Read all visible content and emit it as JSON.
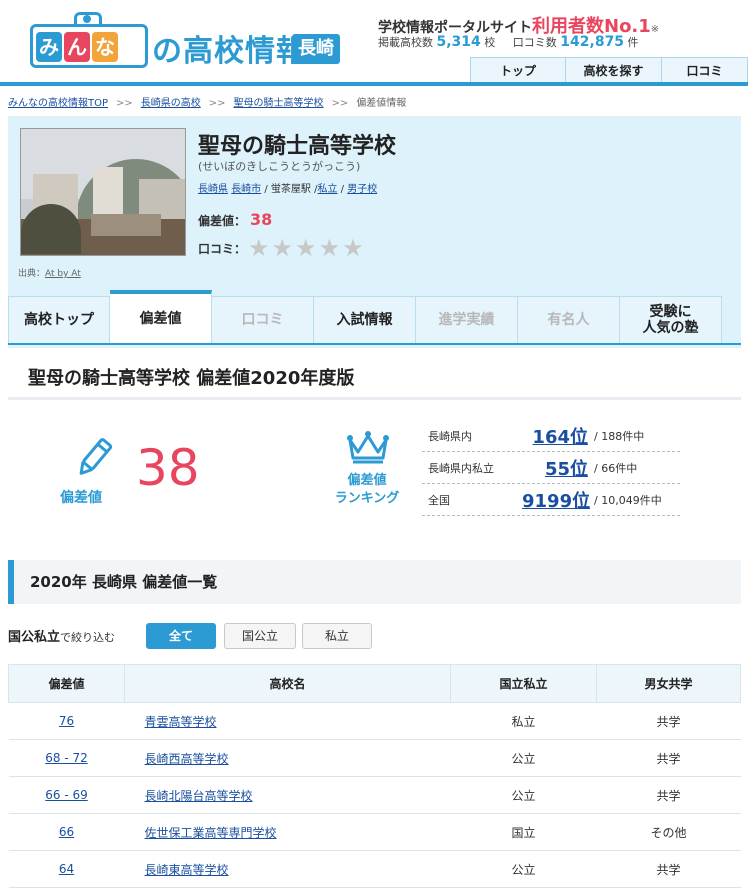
{
  "logo": {
    "chars": [
      {
        "text": "み",
        "color": "#2c9ad3"
      },
      {
        "text": "ん",
        "color": "#e8465e"
      },
      {
        "text": "な",
        "color": "#f2a33a"
      }
    ],
    "main": "の高校情報",
    "pref": "長崎"
  },
  "tagline": {
    "prefix": "学校情報ポータルサイト",
    "highlight": "利用者数No.1",
    "mark": "※"
  },
  "stats": {
    "schools_label": "掲載高校数",
    "schools_value": "5,314",
    "schools_unit": "校",
    "reviews_label": "口コミ数",
    "reviews_value": "142,875",
    "reviews_unit": "件"
  },
  "topnav": [
    "トップ",
    "高校を探す",
    "口コミ"
  ],
  "breadcrumb": [
    "みんなの高校情報TOP",
    "長崎県の高校",
    "聖母の騎士高等学校",
    "偏差値情報"
  ],
  "breadcrumb_sep": ">>",
  "school": {
    "name": "聖母の騎士高等学校",
    "kana": "(せいぼのきしこうとうがっこう)",
    "meta": [
      "長崎県",
      "長崎市",
      "蛍茶屋駅",
      "私立",
      "男子校"
    ],
    "deviation_label": "偏差値：",
    "deviation_value": "38",
    "review_label": "口コミ：",
    "stars": "★",
    "credit_label": "出典：",
    "credit_link": "At by At"
  },
  "tabs": [
    {
      "label": "高校トップ",
      "state": "normal"
    },
    {
      "label": "偏差値",
      "state": "active"
    },
    {
      "label": "口コミ",
      "state": "disabled"
    },
    {
      "label": "入試情報",
      "state": "normal"
    },
    {
      "label": "進学実績",
      "state": "disabled"
    },
    {
      "label": "有名人",
      "state": "disabled"
    },
    {
      "label": "受験に\n人気の塾",
      "state": "normal"
    }
  ],
  "section_title": "聖母の騎士高等学校 偏差値2020年度版",
  "summary": {
    "dev_label": "偏差値",
    "dev_value": "38",
    "rank_label": "偏差値\nランキング",
    "ranks": [
      {
        "label": "長崎県内",
        "value": "164位",
        "total": "/ 188件中"
      },
      {
        "label": "長崎県内私立",
        "value": "55位",
        "total": "/ 66件中"
      },
      {
        "label": "全国",
        "value": "9199位",
        "total": "/ 10,049件中"
      }
    ]
  },
  "list": {
    "title": "2020年 長崎県 偏差値一覧",
    "filter_label": "国公私立",
    "filter_suffix": "で絞り込む",
    "filters": [
      {
        "label": "全て",
        "on": true
      },
      {
        "label": "国公立",
        "on": false
      },
      {
        "label": "私立",
        "on": false
      }
    ],
    "columns": [
      "偏差値",
      "高校名",
      "国立私立",
      "男女共学"
    ],
    "rows": [
      {
        "dev": "76",
        "name": "青雲高等学校",
        "type": "私立",
        "gender": "共学"
      },
      {
        "dev": "68 - 72",
        "name": "長崎西高等学校",
        "type": "公立",
        "gender": "共学"
      },
      {
        "dev": "66 - 69",
        "name": "長崎北陽台高等学校",
        "type": "公立",
        "gender": "共学"
      },
      {
        "dev": "66",
        "name": "佐世保工業高等専門学校",
        "type": "国立",
        "gender": "その他"
      },
      {
        "dev": "64",
        "name": "長崎東高等学校",
        "type": "公立",
        "gender": "共学"
      }
    ]
  },
  "colors": {
    "accent": "#2c9ad3",
    "highlight": "#e8465e",
    "link": "#1a4fa0"
  }
}
